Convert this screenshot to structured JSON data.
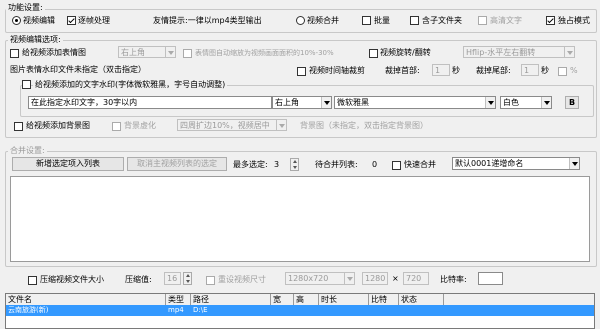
{
  "function_settings": {
    "title": "功能设置:",
    "mode_video_edit": "视频编辑",
    "frame_by_frame": "逐帧处理",
    "tip": "友情提示:一律以mp4类型输出",
    "mode_video_merge": "视频合并",
    "batch": "批量",
    "include_subfolders": "含子文件夹",
    "hd_text": "高清文字",
    "exclusive_mode": "独占模式"
  },
  "edit_options": {
    "title": "视频编辑选项:",
    "add_emoji": "给视频添加表情图",
    "emoji_position": "右上角",
    "emoji_scale_note": "表情图自动缩放为视频画面面积的10%-30%",
    "rotate_flip": "视频旋转/翻转",
    "flip_option": "Hflip-水平左右翻转",
    "emoji_watermark_file": "图片表情水印文件未指定（双击指定）",
    "time_trim": "视频时间轴裁剪",
    "trim_start_label": "裁掉首部:",
    "trim_start_value": "1",
    "sec1": "秒",
    "trim_end_label": "裁掉尾部:",
    "trim_end_value": "1",
    "sec2": "秒",
    "percent": "%",
    "text_watermark_group": "给视频添加的文字水印(字体微软雅黑，字号自动调整)",
    "text_watermark_input": "在此指定水印文字，30字以内",
    "text_position": "右上角",
    "font": "微软雅黑",
    "color": "白色",
    "bold_button": "B",
    "add_background": "给视频添加背景图",
    "bg_blur": "背景虚化",
    "expand_option": "四周扩边10%，视频居中",
    "bg_image_note": "背景图（未指定，双击指定背景图）"
  },
  "merge_settings": {
    "title": "合并设置:",
    "add_selected_button": "新增选定项入列表",
    "cancel_main_button": "取消主视频列表的选定",
    "max_select_label": "最多选定:",
    "max_select_value": "3",
    "pending_label": "待合并列表:",
    "pending_count": "0",
    "quick_merge": "快速合并",
    "naming_option": "默认0001递增命名"
  },
  "bottom_bar": {
    "compress_size": "压缩视频文件大小",
    "compress_value_label": "压缩值:",
    "compress_value": "16",
    "resize": "重设视频尺寸",
    "resolution_option": "1280x720",
    "width": "1280",
    "times": "×",
    "height": "720",
    "ratio_label": "比特率:"
  },
  "file_table": {
    "columns": [
      "文件名",
      "类型",
      "路径",
      "宽",
      "高",
      "时长",
      "比特",
      "状态"
    ],
    "rows": [
      {
        "name": "云南旅游(新)",
        "type": "mp4",
        "path": "D:\\E",
        "width": "",
        "height": "",
        "duration": "",
        "bitrate": "",
        "status": ""
      }
    ]
  },
  "colors": {
    "window_bg": "#f0f0f0",
    "selection": "#3399ff",
    "border": "#c8c8c8"
  }
}
